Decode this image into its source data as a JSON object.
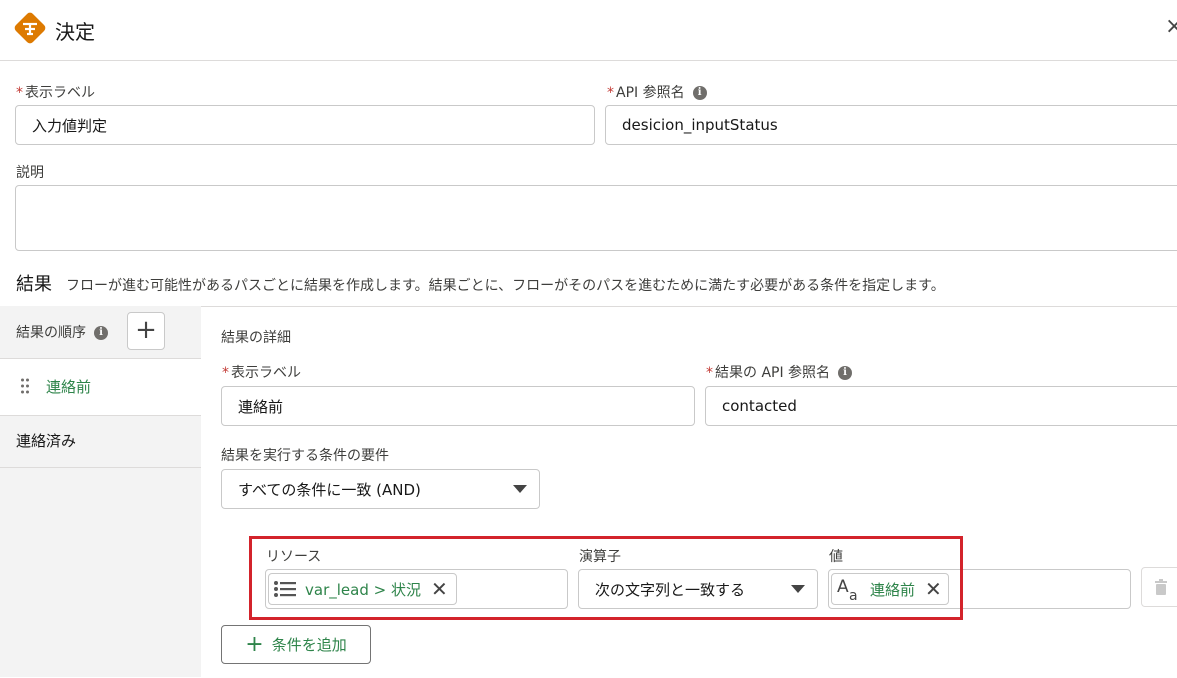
{
  "header": {
    "title": "決定",
    "close_label": "×"
  },
  "form": {
    "label_field": {
      "label": "表示ラベル",
      "value": "入力値判定"
    },
    "api_field": {
      "label": "API 参照名",
      "value": "desicion_inputStatus"
    },
    "description": {
      "label": "説明",
      "value": ""
    }
  },
  "outcomes_section": {
    "title": "結果",
    "description": "フローが進む可能性があるパスごとに結果を作成します。結果ごとに、フローがそのパスを進むために満たす必要がある条件を指定します。",
    "order_label": "結果の順序",
    "add_label": "+",
    "items": [
      {
        "label": "連絡前"
      },
      {
        "label": "連絡済み"
      }
    ]
  },
  "detail": {
    "title": "結果の詳細",
    "label_field": {
      "label": "表示ラベル",
      "value": "連絡前"
    },
    "api_field": {
      "label": "結果の API 参照名",
      "value": "contacted"
    },
    "requirement": {
      "label": "結果を実行する条件の要件",
      "value": "すべての条件に一致 (AND)"
    },
    "condition": {
      "resource_label": "リソース",
      "resource_value": "var_lead > 状況",
      "operator_label": "演算子",
      "operator_value": "次の文字列と一致する",
      "value_label": "値",
      "value_value": "連絡前"
    },
    "add_condition_label": "条件を追加"
  },
  "colors": {
    "accent_green": "#2e844a",
    "highlight_red": "#d3232b",
    "logo_orange": "#dd7a01"
  }
}
